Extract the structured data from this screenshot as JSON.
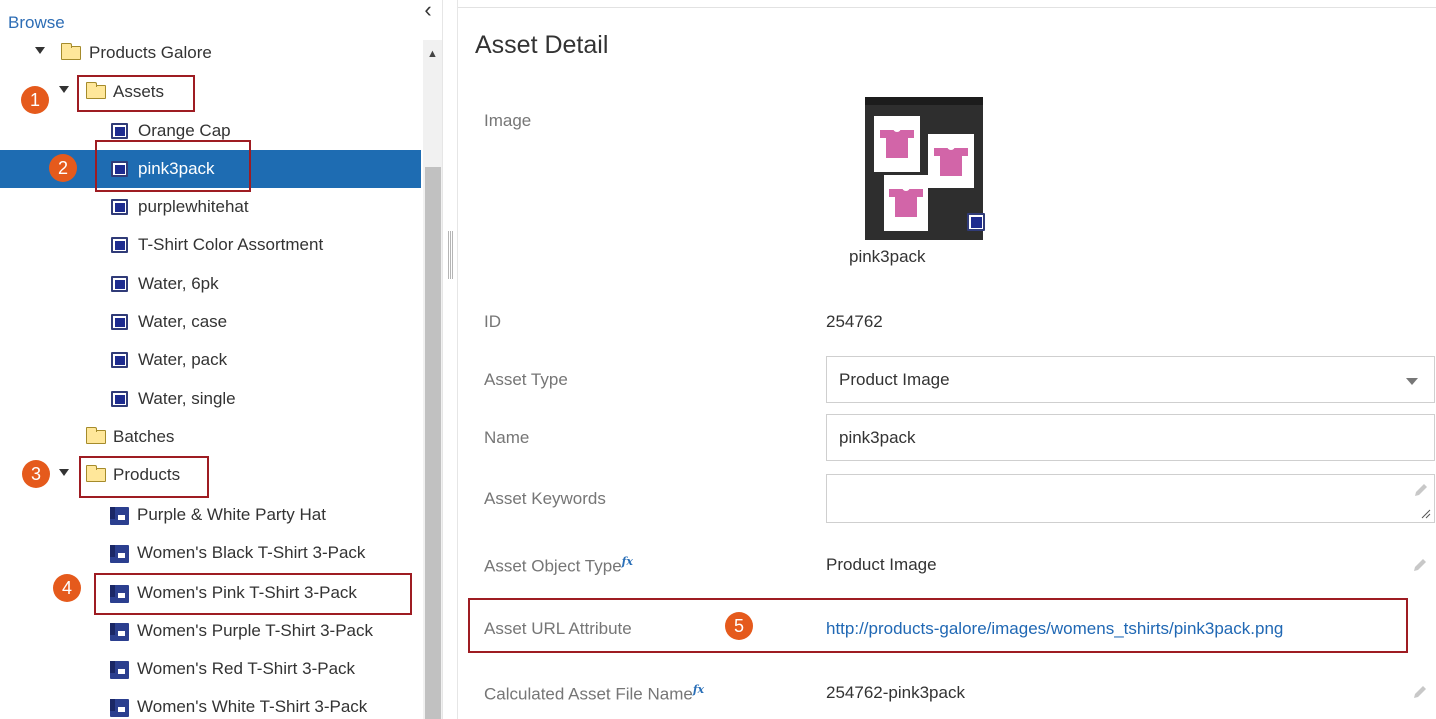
{
  "browse_panel": {
    "title": "Browse",
    "collapse_icon": "chevron-left-icon",
    "tree": {
      "root": "Products Galore",
      "assets_folder": "Assets",
      "assets": [
        "Orange Cap",
        "pink3pack",
        "purplewhitehat",
        "T-Shirt Color Assortment",
        "Water, 6pk",
        "Water, case",
        "Water, pack",
        "Water, single"
      ],
      "batches_folder": "Batches",
      "products_folder": "Products",
      "products": [
        "Purple & White Party Hat",
        "Women's Black T-Shirt 3-Pack",
        "Women's Pink T-Shirt 3-Pack",
        "Women's Purple T-Shirt 3-Pack",
        "Women's Red T-Shirt 3-Pack",
        "Women's White T-Shirt 3-Pack"
      ]
    }
  },
  "markers": [
    "1",
    "2",
    "3",
    "4",
    "5"
  ],
  "detail": {
    "title": "Asset Detail",
    "image_label": "Image",
    "image_name": "pink3pack",
    "id_label": "ID",
    "id_value": "254762",
    "asset_type_label": "Asset Type",
    "asset_type_value": "Product Image",
    "name_label": "Name",
    "name_value": "pink3pack",
    "keywords_label": "Asset Keywords",
    "keywords_value": "",
    "object_type_label": "Asset Object Type",
    "object_type_value": "Product Image",
    "url_label": "Asset URL Attribute",
    "url_value": "http://products-galore/images/womens_tshirts/pink3pack.png",
    "file_name_label": "Calculated Asset File Name",
    "file_name_value": "254762-pink3pack",
    "fx_symbol": "fx"
  },
  "colors": {
    "selected_row": "#1e6cb2",
    "marker": "#e55a1c",
    "callout_border": "#9e1c22",
    "link": "#2068b4"
  }
}
